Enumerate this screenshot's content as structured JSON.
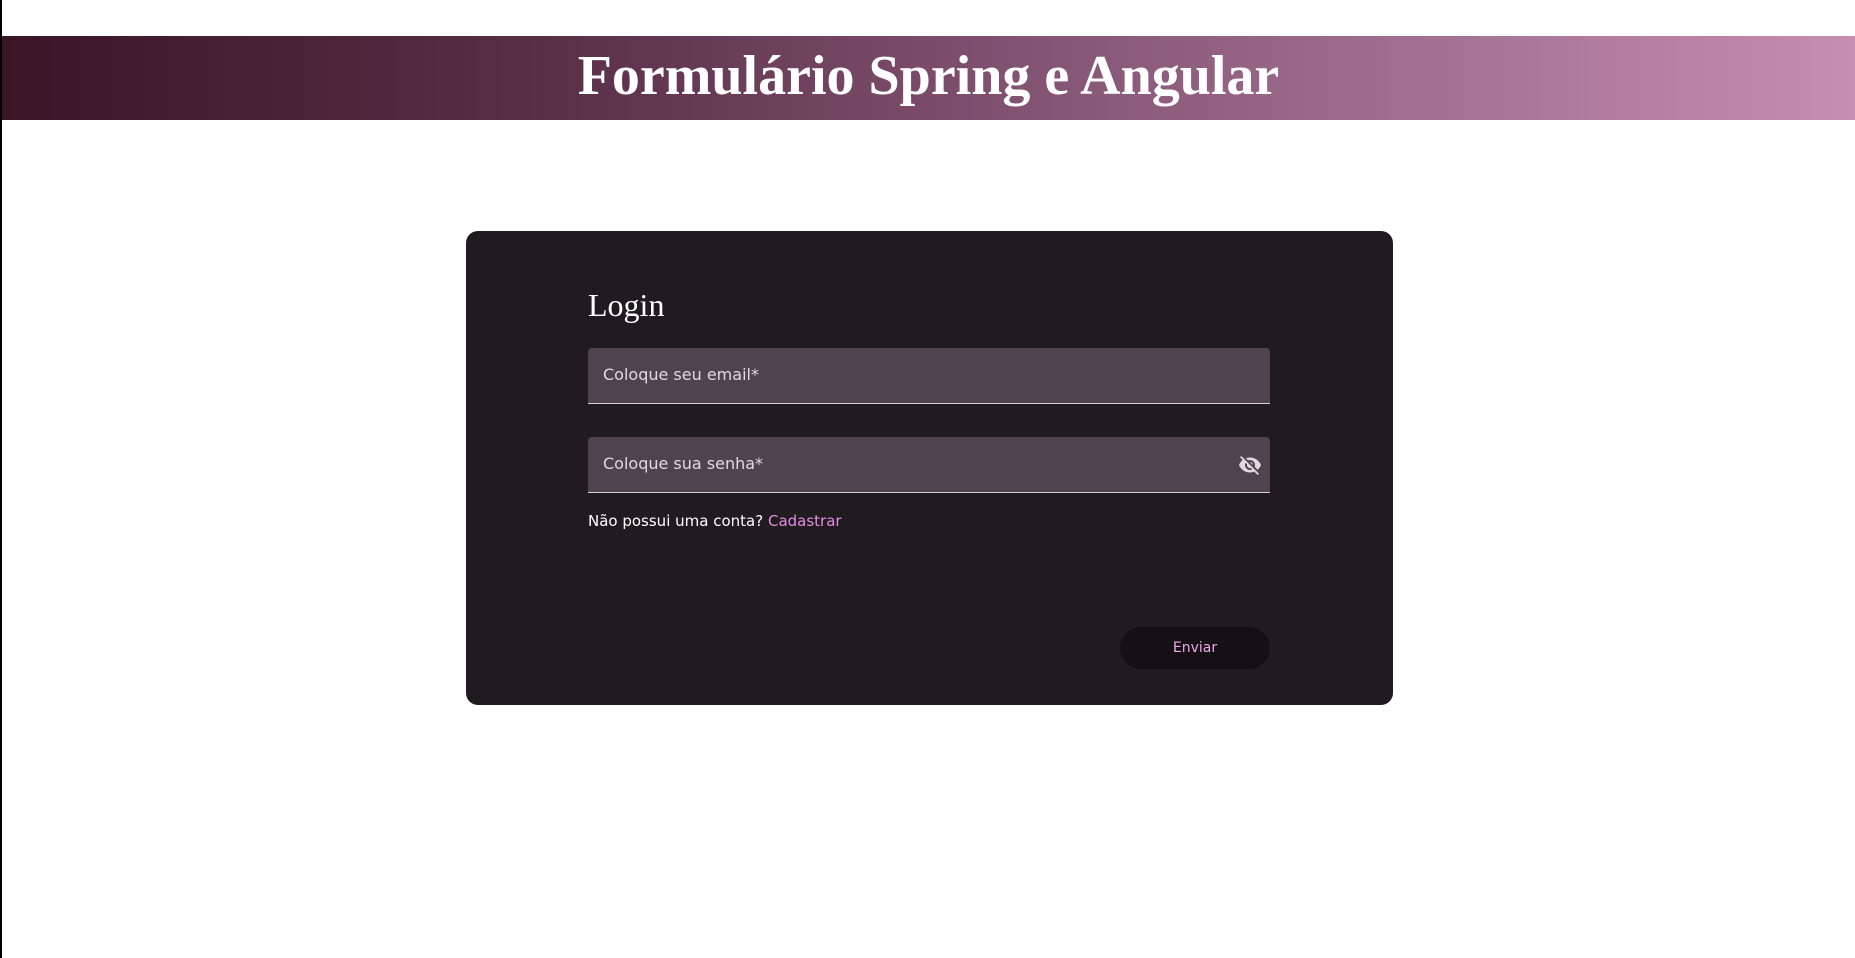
{
  "header": {
    "title": "Formulário Spring e Angular"
  },
  "login_form": {
    "title": "Login",
    "email_field": {
      "label": "Coloque seu email*",
      "value": ""
    },
    "password_field": {
      "label": "Coloque sua senha*",
      "value": "",
      "toggle_icon": "eye-off-icon"
    },
    "signup_prompt": "Não possui uma conta?",
    "signup_link": "Cadastrar",
    "submit_label": "Enviar"
  },
  "colors": {
    "header_gradient_start": "#3a1526",
    "header_gradient_end": "#c58eb3",
    "card_background": "#201b1f",
    "field_background": "#4f444d",
    "link_color": "#e58ce6",
    "button_text": "#f2a6ef"
  }
}
